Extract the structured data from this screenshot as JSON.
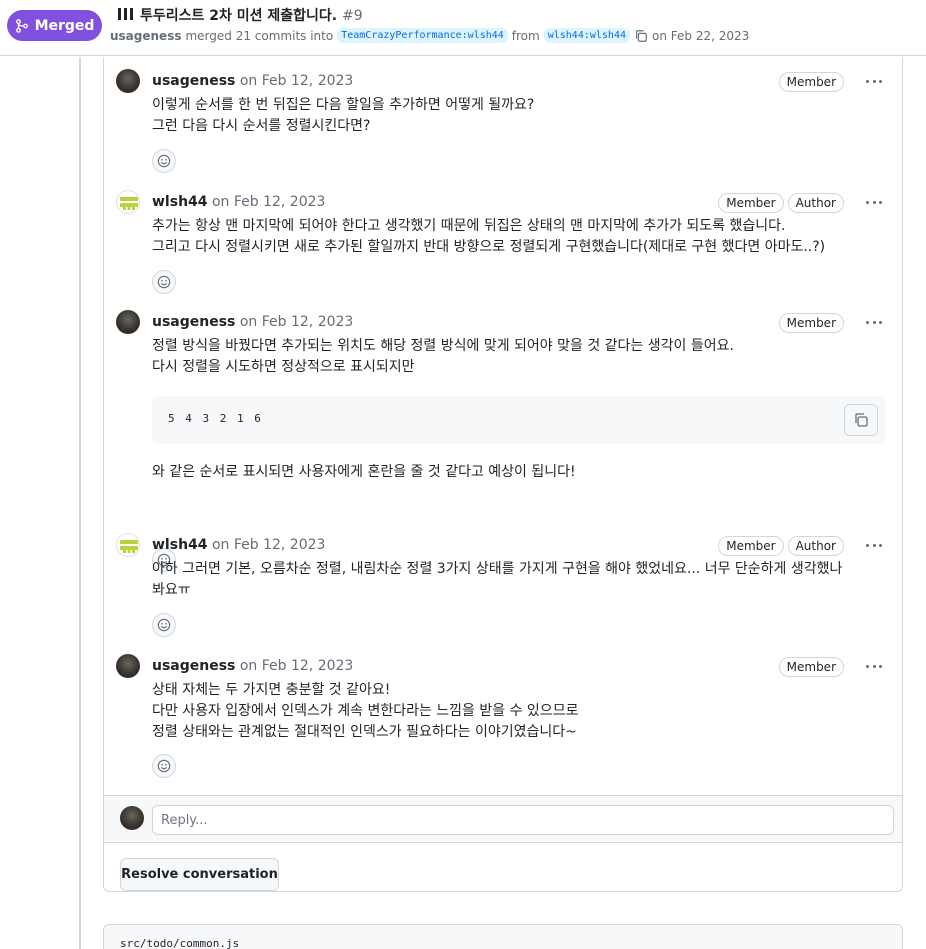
{
  "header": {
    "status_label": "Merged",
    "title": "투두리스트 2차 미션 제출합니다.",
    "number": "#9",
    "meta": {
      "user": "usageness",
      "merged_text": "merged 21 commits into",
      "base_branch": "TeamCrazyPerformance:wlsh44",
      "from_text": "from",
      "head_branch": "wlsh44:wlsh44",
      "date_text": "on Feb 22, 2023"
    }
  },
  "comments": [
    {
      "author": "usageness",
      "timestamp": "on Feb 12, 2023",
      "labels": [
        "Member"
      ],
      "lines": [
        "이렇게 순서를 한 번 뒤집은 다음 할일을 추가하면 어떻게 될까요?",
        "그런 다음 다시 순서를 정렬시킨다면?"
      ]
    },
    {
      "author": "wlsh44",
      "timestamp": "on Feb 12, 2023",
      "labels": [
        "Member",
        "Author"
      ],
      "lines": [
        "추가는 항상 맨 마지막에 되어야 한다고 생각했기 때문에 뒤집은 상태의 맨 마지막에 추가가 되도록 했습니다.",
        "그리고 다시 정렬시키면 새로 추가된 할일까지 반대 방향으로 정렬되게 구현했습니다(제대로 구현 했다면 아마도..?)"
      ]
    },
    {
      "author": "usageness",
      "timestamp": "on Feb 12, 2023",
      "labels": [
        "Member"
      ],
      "lines": [
        "정렬 방식을 바꿨다면 추가되는 위치도 해당 정렬 방식에 맞게 되어야 맞을 것 같다는 생각이 들어요.",
        "다시 정렬을 시도하면 정상적으로 표시되지만"
      ],
      "code": "5 4 3 2 1 6",
      "after": "와 같은 순서로 표시되면 사용자에게 혼란을 줄 것 같다고 예상이 됩니다!"
    },
    {
      "author": "wlsh44",
      "timestamp": "on Feb 12, 2023",
      "labels": [
        "Member",
        "Author"
      ],
      "lines": [
        "아하 그러면 기본, 오름차순 정렬, 내림차순 정렬 3가지 상태를 가지게 구현을 해야 했었네요... 너무 단순하게 생각했나",
        "봐요ㅠ"
      ]
    },
    {
      "author": "usageness",
      "timestamp": "on Feb 12, 2023",
      "labels": [
        "Member"
      ],
      "lines": [
        "상태 자체는 두 가지면 충분할 것 같아요!",
        "다만 사용자 입장에서 인덱스가 계속 변한다라는 느낌을 받을 수 있으므로",
        "정렬 상태와는 관계없는 절대적인 인덱스가 필요하다는 이야기였습니다~"
      ]
    }
  ],
  "reply": {
    "placeholder": "Reply..."
  },
  "resolve_label": "Resolve conversation",
  "file": {
    "path": "src/todo/common.js"
  },
  "colors": {
    "merged": "#8250df",
    "link": "#0969da",
    "border": "#d0d7de"
  }
}
